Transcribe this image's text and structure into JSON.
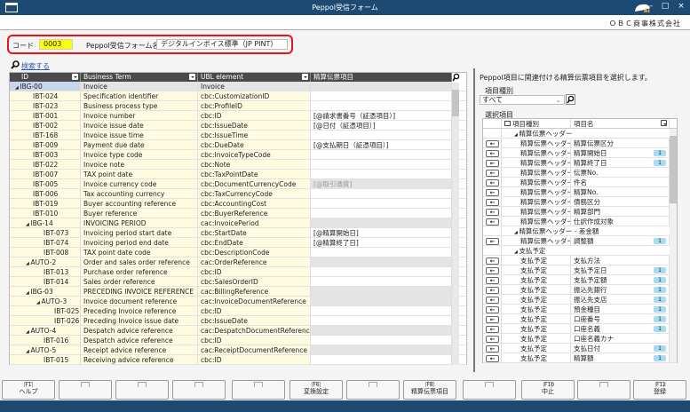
{
  "window": {
    "title": "Peppol受信フォーム",
    "company": "ＯＢＣ商事株式会社",
    "minimize": "–",
    "maximize": "□",
    "close": "×",
    "colors": {
      "titlebar": "#1d4a73",
      "highlight": "#e8141b"
    }
  },
  "form": {
    "code_label": "コード",
    "code_value": "0003",
    "name_label": "Peppol受信フォーム名",
    "name_value": "デジタルインボイス標準（JP PINT）"
  },
  "search_link": "検索する",
  "grid": {
    "headers": [
      "ID",
      "Business Term",
      "UBL element",
      "精算伝票項目"
    ],
    "rows": [
      {
        "id": "IBG-00",
        "term": "Invoice",
        "ubl": "Invoice",
        "map": "",
        "level": 0,
        "group": true
      },
      {
        "id": "IBT-024",
        "term": "Specification identifier",
        "ubl": "cbc:CustomizationID",
        "map": "",
        "level": 1
      },
      {
        "id": "IBT-023",
        "term": "Business process type",
        "ubl": "cbc:ProfileID",
        "map": "",
        "level": 1
      },
      {
        "id": "IBT-001",
        "term": "Invoice number",
        "ubl": "cbc:ID",
        "map": "[@請求書番号（証憑項目）]",
        "level": 1
      },
      {
        "id": "IBT-002",
        "term": "Invoice issue date",
        "ubl": "cbc:IssueDate",
        "map": "[@日付（証憑項目）]",
        "level": 1
      },
      {
        "id": "IBT-168",
        "term": "Invoice issue time",
        "ubl": "cbc:IssueTime",
        "map": "",
        "level": 1
      },
      {
        "id": "IBT-009",
        "term": "Payment due date",
        "ubl": "cbc:DueDate",
        "map": "[@支払期日（証憑項目）]",
        "level": 1
      },
      {
        "id": "IBT-003",
        "term": "Invoice type code",
        "ubl": "cbc:InvoiceTypeCode",
        "map": "",
        "level": 1
      },
      {
        "id": "IBT-022",
        "term": "Invoice note",
        "ubl": "cbc:Note",
        "map": "",
        "level": 1
      },
      {
        "id": "IBT-007",
        "term": "TAX point date",
        "ubl": "cbc:TaxPointDate",
        "map": "",
        "level": 1
      },
      {
        "id": "IBT-005",
        "term": "Invoice currency code",
        "ubl": "cbc:DocumentCurrencyCode",
        "map": "[@取引通貨]",
        "level": 1,
        "disabled": true
      },
      {
        "id": "IBT-006",
        "term": "Tax accounting currency",
        "ubl": "cbc:TaxCurrencyCode",
        "map": "",
        "level": 1
      },
      {
        "id": "IBT-019",
        "term": "Buyer accounting reference",
        "ubl": "cbc:AccountingCost",
        "map": "",
        "level": 1
      },
      {
        "id": "IBT-010",
        "term": "Buyer reference",
        "ubl": "cbc:BuyerReference",
        "map": "",
        "level": 1
      },
      {
        "id": "IBG-14",
        "term": "INVOICING PERIOD",
        "ubl": "cac:InvoicePeriod",
        "map": "",
        "level": 1,
        "group": true
      },
      {
        "id": "IBT-073",
        "term": "Invoicing period start date",
        "ubl": "cbc:StartDate",
        "map": "[@精算開始日]",
        "level": 2
      },
      {
        "id": "IBT-074",
        "term": "Invoicing period end date",
        "ubl": "cbc:EndDate",
        "map": "[@精算終了日]",
        "level": 2
      },
      {
        "id": "IBT-008",
        "term": "TAX point date code",
        "ubl": "cbc:DescriptionCode",
        "map": "",
        "level": 2
      },
      {
        "id": "AUTO-2",
        "term": "Order and sales order reference",
        "ubl": "cac:OrderReference",
        "map": "",
        "level": 1,
        "group": true
      },
      {
        "id": "IBT-013",
        "term": "Purchase order reference",
        "ubl": "cbc:ID",
        "map": "",
        "level": 2
      },
      {
        "id": "IBT-014",
        "term": "Sales order reference",
        "ubl": "cbc:SalesOrderID",
        "map": "",
        "level": 2
      },
      {
        "id": "IBG-03",
        "term": "PRECEDING INVOICE REFERENCE",
        "ubl": "cac:BillingReference",
        "map": "",
        "level": 1,
        "group": true
      },
      {
        "id": "AUTO-3",
        "term": "Invoice document reference",
        "ubl": "cac:InvoiceDocumentReference",
        "map": "",
        "level": 2,
        "group": true
      },
      {
        "id": "IBT-025",
        "term": "Preceding Invoice reference",
        "ubl": "cbc:ID",
        "map": "",
        "level": 3
      },
      {
        "id": "IBT-026",
        "term": "Preceding Invoice issue date",
        "ubl": "cbc:IssueDate",
        "map": "",
        "level": 3
      },
      {
        "id": "AUTO-4",
        "term": "Despatch advice reference",
        "ubl": "cac:DespatchDocumentReference",
        "map": "",
        "level": 1,
        "group": true
      },
      {
        "id": "IBT-016",
        "term": "Despatch advice reference",
        "ubl": "cbc:ID",
        "map": "",
        "level": 2
      },
      {
        "id": "AUTO-5",
        "term": "Receipt advice reference",
        "ubl": "cac:ReceiptDocumentReference",
        "map": "",
        "level": 1,
        "group": true
      },
      {
        "id": "IBT-015",
        "term": "Receiving advice reference",
        "ubl": "cbc:ID",
        "map": "",
        "level": 2
      }
    ]
  },
  "right": {
    "instruction": "Peppol項目に関連付ける精算伝票項目を選択します。",
    "type_label": "項目種別",
    "type_value": "すべて",
    "selection_label": "選択項目",
    "headers": [
      "項目種別",
      "項目名"
    ],
    "rows": [
      {
        "group": "精算伝票ヘッダー"
      },
      {
        "type": "精算伝票ヘッダー",
        "name": "精算伝票区分",
        "badge": ""
      },
      {
        "type": "精算伝票ヘッダー",
        "name": "精算開始日",
        "badge": "1"
      },
      {
        "type": "精算伝票ヘッダー",
        "name": "精算終了日",
        "badge": "1"
      },
      {
        "type": "精算伝票ヘッダー",
        "name": "伝票No.",
        "badge": ""
      },
      {
        "type": "精算伝票ヘッダー",
        "name": "件名",
        "badge": ""
      },
      {
        "type": "精算伝票ヘッダー",
        "name": "精算No.",
        "badge": ""
      },
      {
        "type": "精算伝票ヘッダー",
        "name": "債務区分",
        "badge": ""
      },
      {
        "type": "精算伝票ヘッダー",
        "name": "精算部門",
        "badge": ""
      },
      {
        "type": "精算伝票ヘッダー",
        "name": "仕訳作成対象",
        "badge": ""
      },
      {
        "group": "精算伝票ヘッダー - 差金額"
      },
      {
        "type": "精算伝票ヘッダー",
        "name": "調整額",
        "badge": "1"
      },
      {
        "group": "支払予定"
      },
      {
        "type": "支払予定",
        "name": "支払方法",
        "badge": ""
      },
      {
        "type": "支払予定",
        "name": "支払予定日",
        "badge": "1"
      },
      {
        "type": "支払予定",
        "name": "支払予定額",
        "badge": "1"
      },
      {
        "type": "支払予定",
        "name": "振込先銀行",
        "badge": "1"
      },
      {
        "type": "支払予定",
        "name": "振込先支店",
        "badge": "1"
      },
      {
        "type": "支払予定",
        "name": "預金種目",
        "badge": "1"
      },
      {
        "type": "支払予定",
        "name": "口座番号",
        "badge": "1"
      },
      {
        "type": "支払予定",
        "name": "口座名義",
        "badge": "1"
      },
      {
        "type": "支払予定",
        "name": "口座名義カナ",
        "badge": ""
      },
      {
        "type": "支払予定",
        "name": "支払日付",
        "badge": "1"
      },
      {
        "type": "支払予定",
        "name": "精算額",
        "badge": "1"
      }
    ]
  },
  "function_keys": [
    {
      "key": "F1",
      "label": "ヘルプ"
    },
    {
      "key": "",
      "label": ""
    },
    {
      "key": "",
      "label": ""
    },
    {
      "key": "",
      "label": ""
    },
    {
      "key": "",
      "label": ""
    },
    {
      "key": "F6",
      "label": "変換設定"
    },
    {
      "key": "",
      "label": ""
    },
    {
      "key": "F8",
      "label": "精算伝票項目"
    },
    {
      "key": "",
      "label": ""
    },
    {
      "key": "F10",
      "label": "中止"
    },
    {
      "key": "",
      "label": ""
    },
    {
      "key": "F12",
      "label": "登録"
    }
  ]
}
